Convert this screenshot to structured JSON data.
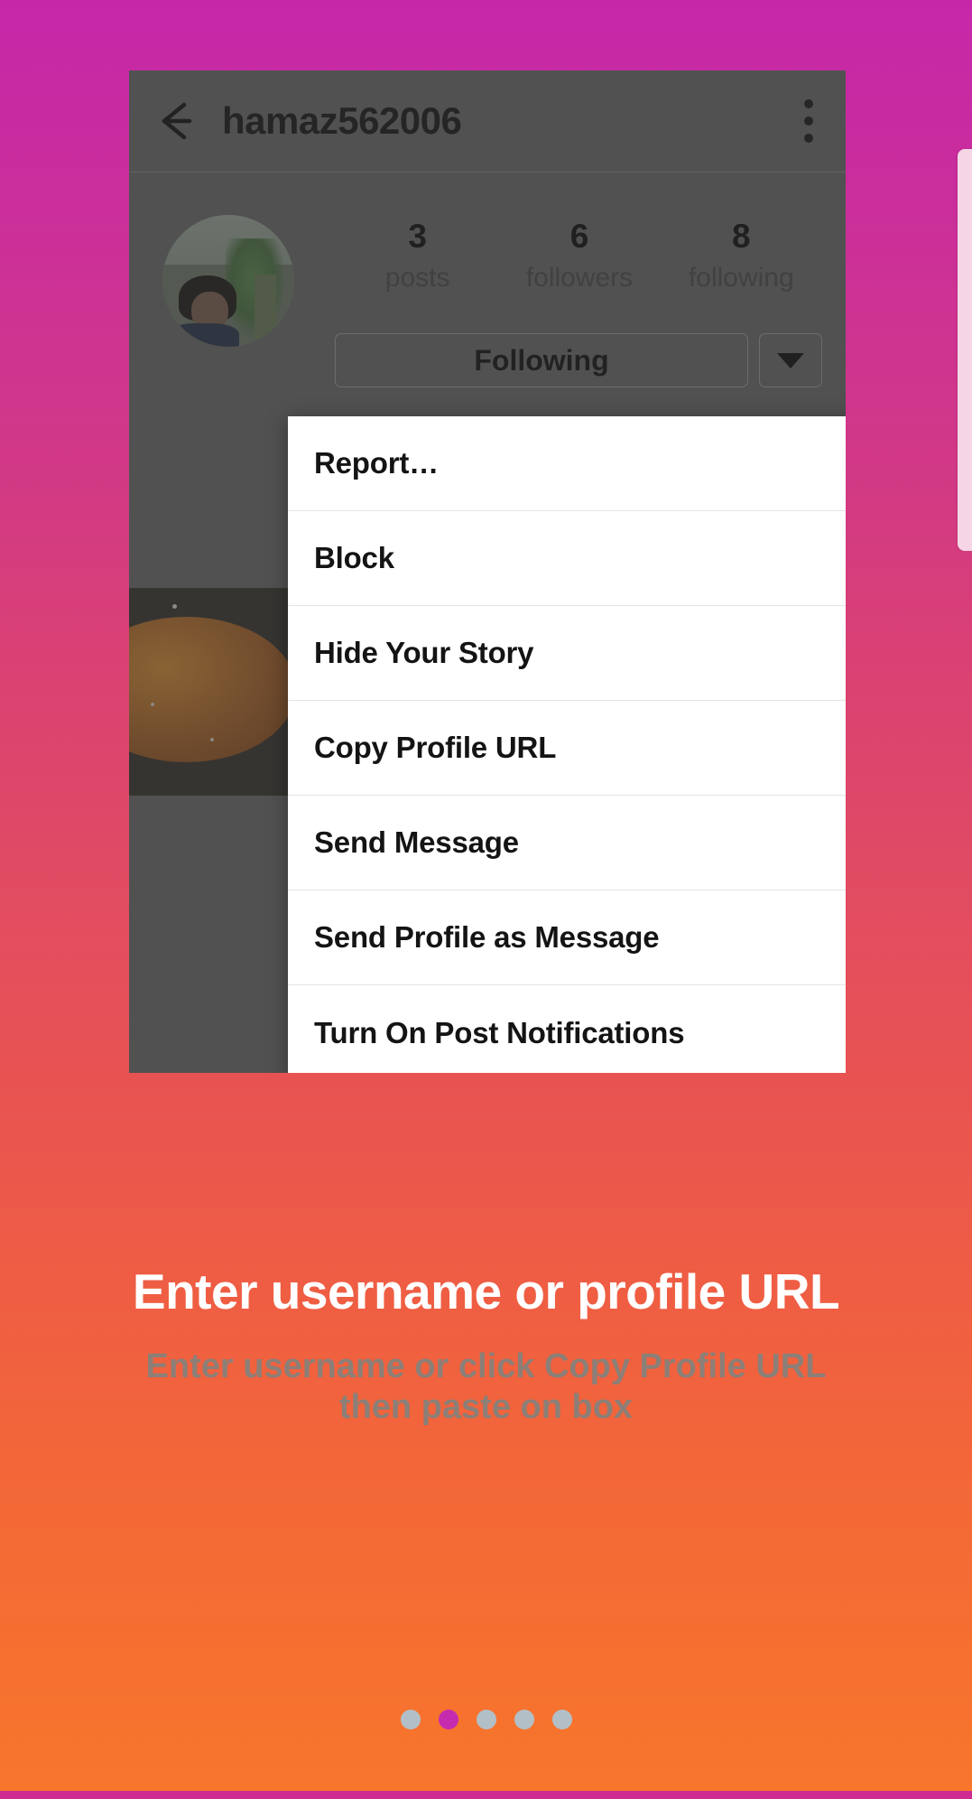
{
  "theme": {
    "gradient_top": "#C627A9",
    "gradient_bottom": "#F7762C",
    "bottom_strip": "#CE2A92",
    "dot_active": "#C52BAF",
    "dot_inactive": "#B3BFC6",
    "scrollbar": "#F6D6E6",
    "sheet_bg": "#FFFFFF",
    "overlay": "rgba(50,50,50,0.45)"
  },
  "phone": {
    "appbar": {
      "back_icon": "arrow-left-icon",
      "title": "hamaz562006",
      "overflow_icon": "more-vertical-icon"
    },
    "profile": {
      "avatar_alt": "profile-photo",
      "stats": [
        {
          "num": "3",
          "label": "posts"
        },
        {
          "num": "6",
          "label": "followers"
        },
        {
          "num": "8",
          "label": "following"
        }
      ],
      "follow_button": "Following",
      "caret_icon": "chevron-down-icon"
    },
    "menu": {
      "items": [
        {
          "label": "Report…"
        },
        {
          "label": "Block"
        },
        {
          "label": "Hide Your Story"
        },
        {
          "label": "Copy Profile URL"
        },
        {
          "label": "Send Message"
        },
        {
          "label": "Send Profile as Message"
        },
        {
          "label": "Turn On Post Notifications"
        }
      ]
    }
  },
  "promo": {
    "title": "Enter username or profile URL",
    "subtitle": "Enter username or click Copy Profile URL then paste on box"
  },
  "pager": {
    "count": 5,
    "active_index": 1
  }
}
